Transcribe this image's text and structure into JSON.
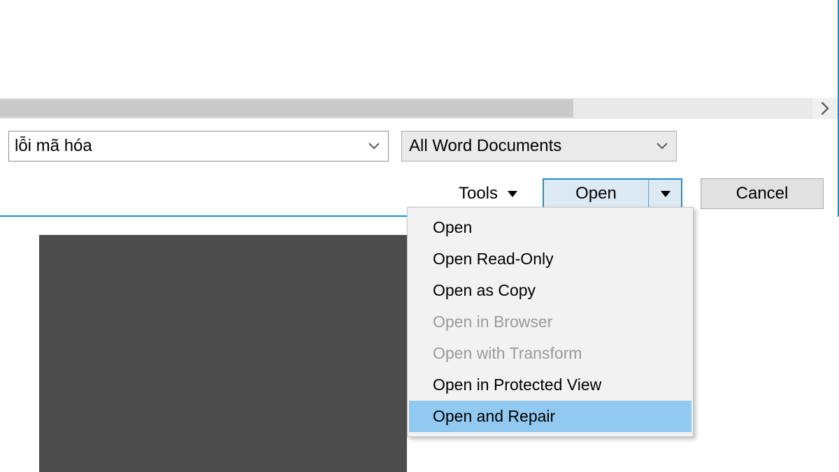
{
  "dialog": {
    "filename_value": "lỗi mã hóa",
    "filter_label": "All Word Documents",
    "tools_label": "Tools",
    "open_button_label": "Open",
    "cancel_button_label": "Cancel"
  },
  "open_menu": {
    "items": [
      {
        "label": "Open",
        "enabled": true,
        "highlight": false
      },
      {
        "label": "Open Read-Only",
        "enabled": true,
        "highlight": false
      },
      {
        "label": "Open as Copy",
        "enabled": true,
        "highlight": false
      },
      {
        "label": "Open in Browser",
        "enabled": false,
        "highlight": false
      },
      {
        "label": "Open with Transform",
        "enabled": false,
        "highlight": false
      },
      {
        "label": "Open in Protected View",
        "enabled": true,
        "highlight": false
      },
      {
        "label": "Open and Repair",
        "enabled": true,
        "highlight": true
      }
    ]
  }
}
